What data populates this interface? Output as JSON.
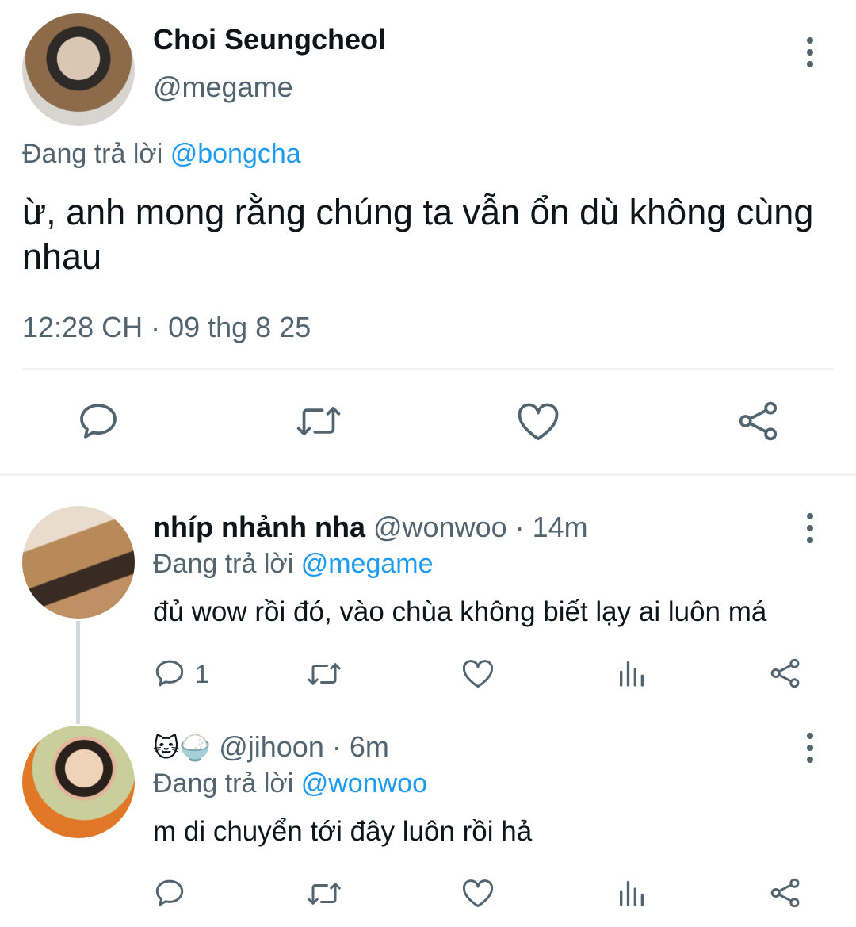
{
  "main_tweet": {
    "display_name": "Choi Seungcheol",
    "handle": "@megame",
    "reply_prefix": "Đang trả lời",
    "reply_to": "@bongcha",
    "text": "ừ, anh mong rằng chúng ta vẫn ổn dù không cùng nhau",
    "timestamp": "12:28 CH · 09 thg 8 25",
    "actions": [
      "reply-icon",
      "retweet-icon",
      "like-icon",
      "share-icon"
    ]
  },
  "replies": [
    {
      "display_name": "nhíp nhảnh nha",
      "handle": "@wonwoo",
      "time": "· 14m",
      "reply_prefix": "Đang trả lời",
      "reply_to": "@megame",
      "text": "đủ wow rồi đó, vào chùa không biết lạy ai luôn má",
      "reply_count": "1"
    },
    {
      "display_name": "🐱🍚",
      "handle": "@jihoon",
      "time": "· 6m",
      "reply_prefix": "Đang trả lời",
      "reply_to": "@wonwoo",
      "text": "m di chuyển tới đây luôn rồi hả",
      "reply_count": ""
    }
  ],
  "colors": {
    "accent": "#1d9bf0",
    "muted": "#536471",
    "divider": "#eff3f4"
  }
}
